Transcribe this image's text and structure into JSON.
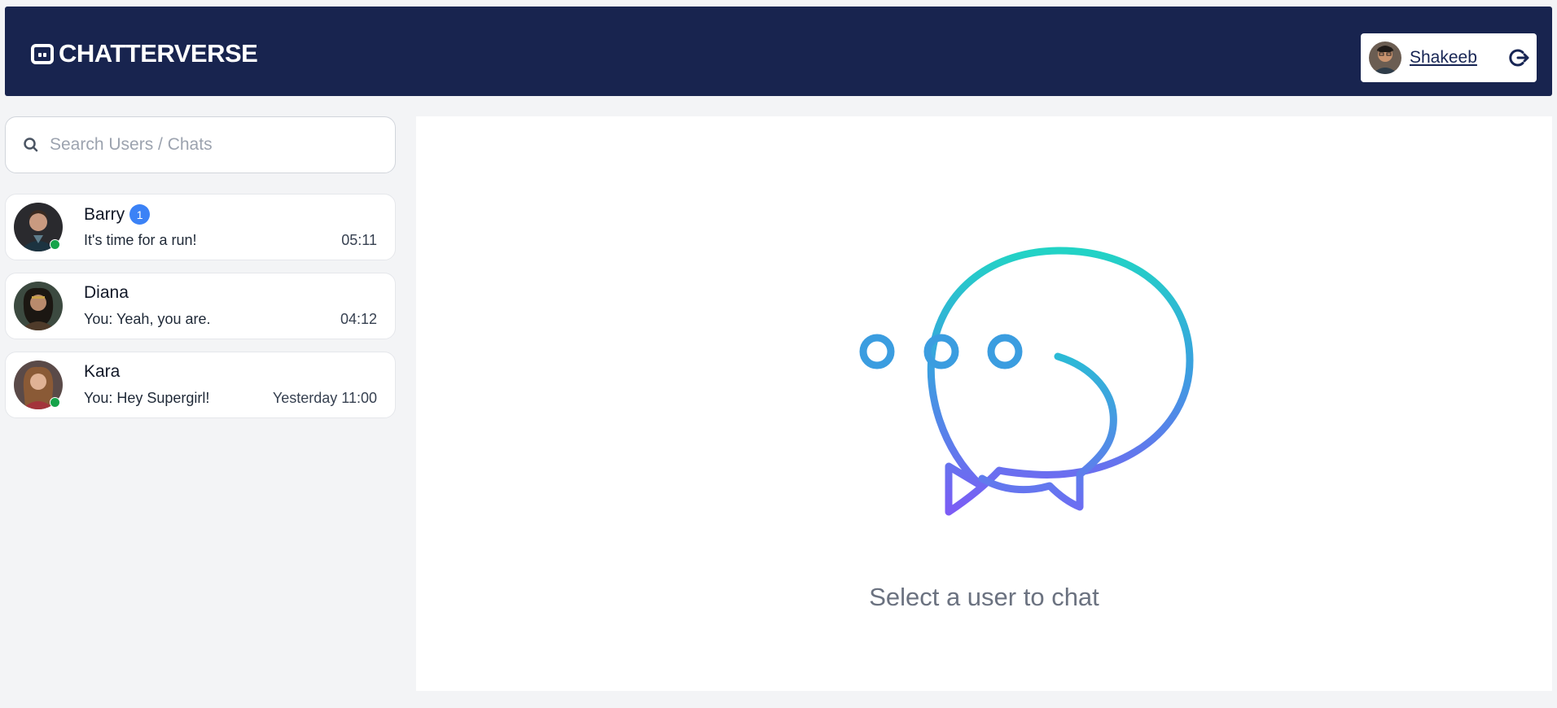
{
  "app": {
    "brand": "CHATTERVERSE",
    "brand_icon": "chat-bot-icon"
  },
  "user": {
    "name": "Shakeeb",
    "logout_icon": "logout-icon"
  },
  "search": {
    "placeholder": "Search Users / Chats",
    "value": ""
  },
  "chats": [
    {
      "name": "Barry",
      "preview": "It's time for a run!",
      "time": "05:11",
      "unread": "1",
      "online": true
    },
    {
      "name": "Diana",
      "preview": "You: Yeah, you are.",
      "time": "04:12",
      "online": false
    },
    {
      "name": "Kara",
      "preview": "You: Hey Supergirl!",
      "time": "Yesterday 11:00",
      "online": true
    }
  ],
  "main": {
    "empty_text": "Select a user to chat"
  },
  "colors": {
    "header_bg": "#18244f",
    "online": "#16a34a",
    "badge": "#3b82f6",
    "gradient_start": "#22d3c5",
    "gradient_end": "#7c5cf5"
  }
}
